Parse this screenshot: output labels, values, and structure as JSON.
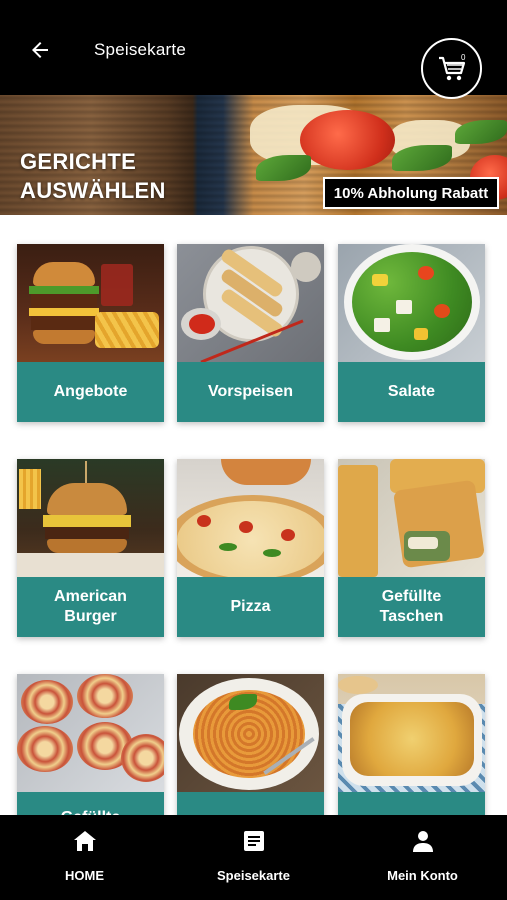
{
  "header": {
    "title": "Speisekarte",
    "cart_count": "0"
  },
  "banner": {
    "title_line1": "GERICHTE",
    "title_line2": "AUSWÄHLEN",
    "promo": "10% Abholung Rabatt"
  },
  "categories": [
    {
      "label": "Angebote",
      "icon": "burger-and-fries"
    },
    {
      "label": "Vorspeisen",
      "icon": "spring-rolls"
    },
    {
      "label": "Salate",
      "icon": "salad-bowl"
    },
    {
      "label": "American\nBurger",
      "icon": "burger"
    },
    {
      "label": "Pizza",
      "icon": "pizza"
    },
    {
      "label": "Gefüllte\nTaschen",
      "icon": "stuffed-pastry"
    },
    {
      "label": "Gefüllte",
      "icon": "pastry-rolls"
    },
    {
      "label": "",
      "icon": "spaghetti"
    },
    {
      "label": "",
      "icon": "casserole"
    }
  ],
  "nav": {
    "home": "HOME",
    "menu": "Speisekarte",
    "account": "Mein Konto"
  },
  "colors": {
    "accent": "#2a8a84",
    "bar": "#000000"
  }
}
